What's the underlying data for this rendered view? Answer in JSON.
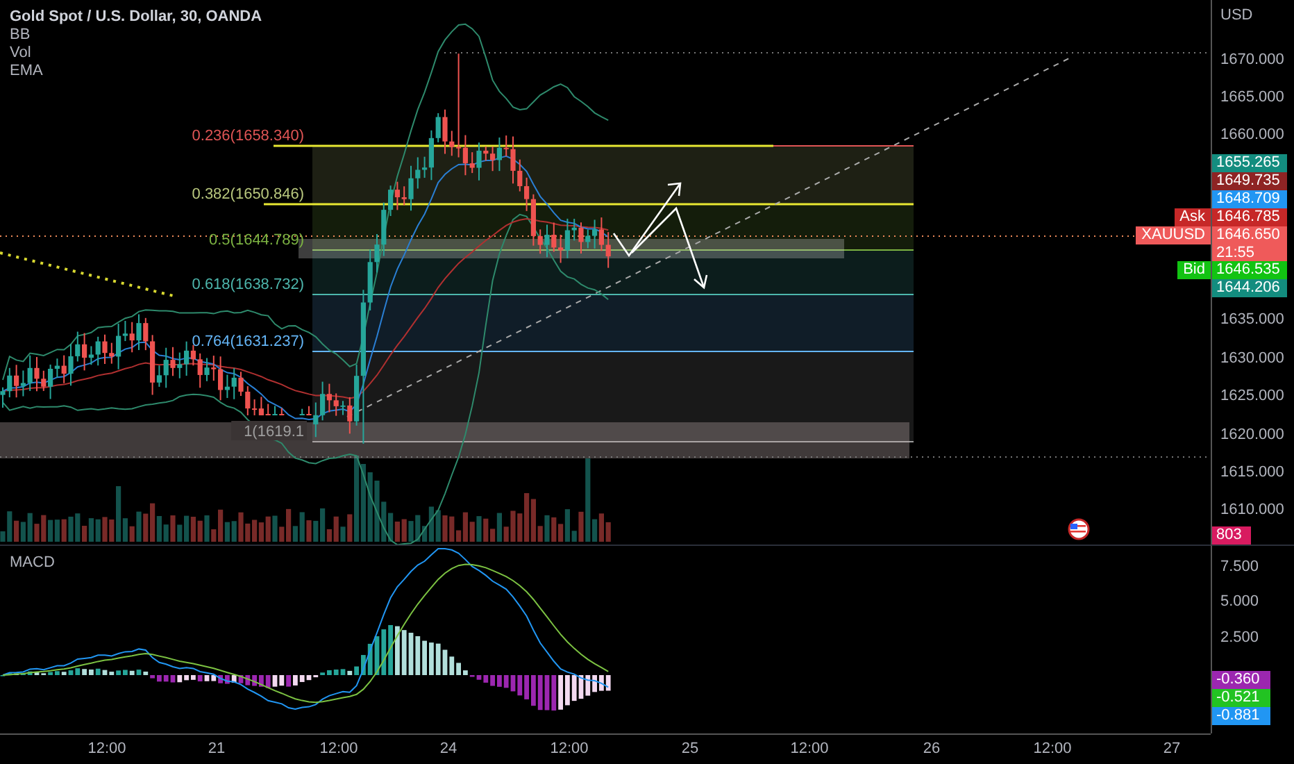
{
  "legend": {
    "title": "Gold Spot / U.S. Dollar, 30, OANDA",
    "indicators": [
      "BB",
      "Vol",
      "EMA"
    ]
  },
  "fib_levels": [
    {
      "label": "0.236(1658.340)",
      "color": "#e05555"
    },
    {
      "label": "0.382(1650.846)",
      "color": "#b9c87e"
    },
    {
      "label": "0.5(1644.789)",
      "color": "#7cb342"
    },
    {
      "label": "0.618(1638.732)",
      "color": "#4db6ac"
    },
    {
      "label": "0.764(1631.237)",
      "color": "#64b5f6"
    },
    {
      "label": "1(1619.1",
      "color": "#9e9e9e"
    }
  ],
  "price_axis": {
    "currency": "USD",
    "ticks": [
      "1670.000",
      "1665.000",
      "1660.000",
      "1635.000",
      "1630.000",
      "1625.000",
      "1620.000",
      "1615.000",
      "1610.000"
    ]
  },
  "price_badges": [
    {
      "value": "1655.265",
      "color": "#138d7f"
    },
    {
      "value": "1649.735",
      "color": "#8e2424"
    },
    {
      "value": "1648.709",
      "color": "#2196f3"
    },
    {
      "value": "1646.785",
      "color": "#c62828",
      "tag": "Ask"
    },
    {
      "value": "1646.650",
      "color": "#ef5a5a",
      "tag": "XAUUSD",
      "countdown": "21:55"
    },
    {
      "value": "1646.535",
      "color": "#12c312",
      "tag": "Bid"
    },
    {
      "value": "1644.206",
      "color": "#138d7f"
    }
  ],
  "volume_badge": {
    "value": "803",
    "color": "#d81b60"
  },
  "macd": {
    "label": "MACD",
    "ticks": [
      "7.500",
      "5.000",
      "2.500"
    ],
    "badges": [
      {
        "value": "-0.360",
        "color": "#9c27b0"
      },
      {
        "value": "-0.521",
        "color": "#22c322"
      },
      {
        "value": "-0.881",
        "color": "#2196f3"
      }
    ]
  },
  "time_axis": [
    "12:00",
    "21",
    "12:00",
    "24",
    "12:00",
    "25",
    "12:00",
    "26",
    "12:00",
    "27"
  ]
}
